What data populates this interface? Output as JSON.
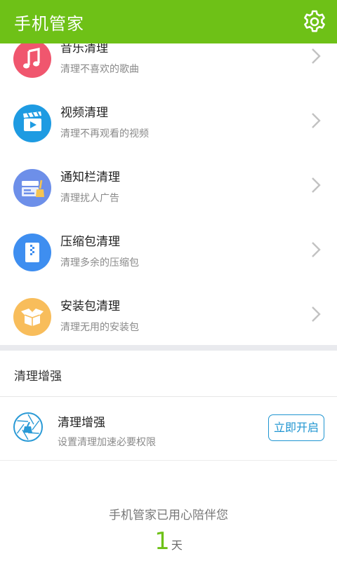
{
  "header": {
    "title": "手机管家",
    "settings_icon": "gear-icon"
  },
  "list": [
    {
      "name": "音乐清理",
      "desc": "清理不喜欢的歌曲",
      "icon": "music-note-icon",
      "color": "#f0566e"
    },
    {
      "name": "视频清理",
      "desc": "清理不再观看的视频",
      "icon": "video-clapper-icon",
      "color": "#1e9be2"
    },
    {
      "name": "通知栏清理",
      "desc": "清理扰人广告",
      "icon": "notification-broom-icon",
      "color": "#6d8fe9"
    },
    {
      "name": "压缩包清理",
      "desc": "清理多余的压缩包",
      "icon": "zip-file-icon",
      "color": "#3e8ef0"
    },
    {
      "name": "安装包清理",
      "desc": "清理无用的安装包",
      "icon": "package-box-icon",
      "color": "#f8bd5b"
    }
  ],
  "section": {
    "title": "清理增强"
  },
  "enhance": {
    "name": "清理增强",
    "desc": "设置清理加速必要权限",
    "button_label": "立即开启",
    "icon": "aperture-broom-icon"
  },
  "footer": {
    "text": "手机管家已用心陪伴您",
    "days_value": "1",
    "days_unit": "天"
  },
  "colors": {
    "brand": "#6ec117",
    "accent": "#1f95d1",
    "divider": "#e9eaee"
  }
}
